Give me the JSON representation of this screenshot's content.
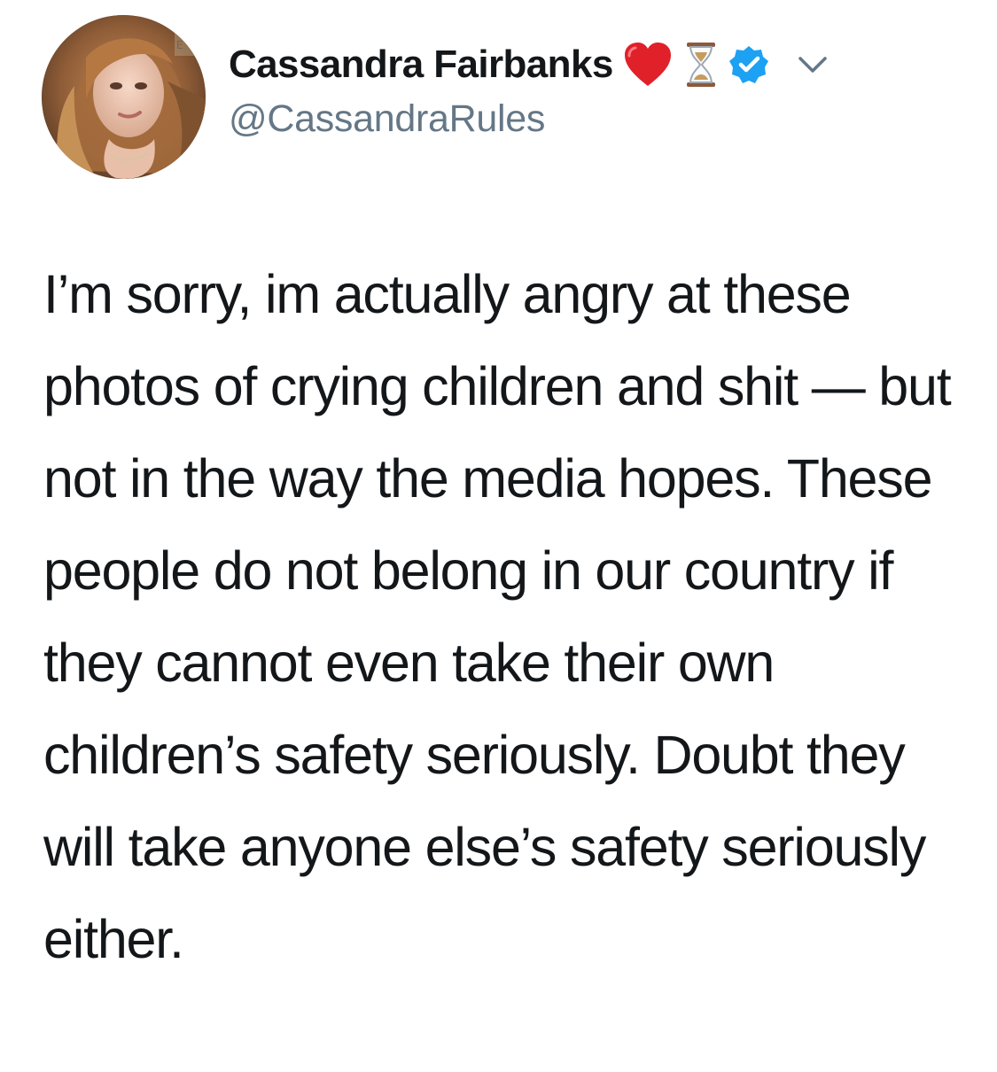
{
  "author": {
    "display_name": "Cassandra Fairbanks",
    "handle": "@CassandraRules",
    "verified": true,
    "badges": [
      "red-heart-icon",
      "hourglass-icon",
      "verified-badge-icon"
    ]
  },
  "tweet": {
    "text": "I’m sorry, im actually angry at these photos of crying children and shit — but not in the way the media hopes. These people do not belong in our country if they cannot even take their own children’s safety seriously. Doubt they will take anyone else’s safety seriously either."
  },
  "icons": {
    "menu": "chevron-down-icon",
    "avatar": "profile-avatar"
  },
  "colors": {
    "text": "#14171a",
    "secondary": "#657786",
    "verified": "#1da1f2",
    "heart": "#e0212a"
  }
}
